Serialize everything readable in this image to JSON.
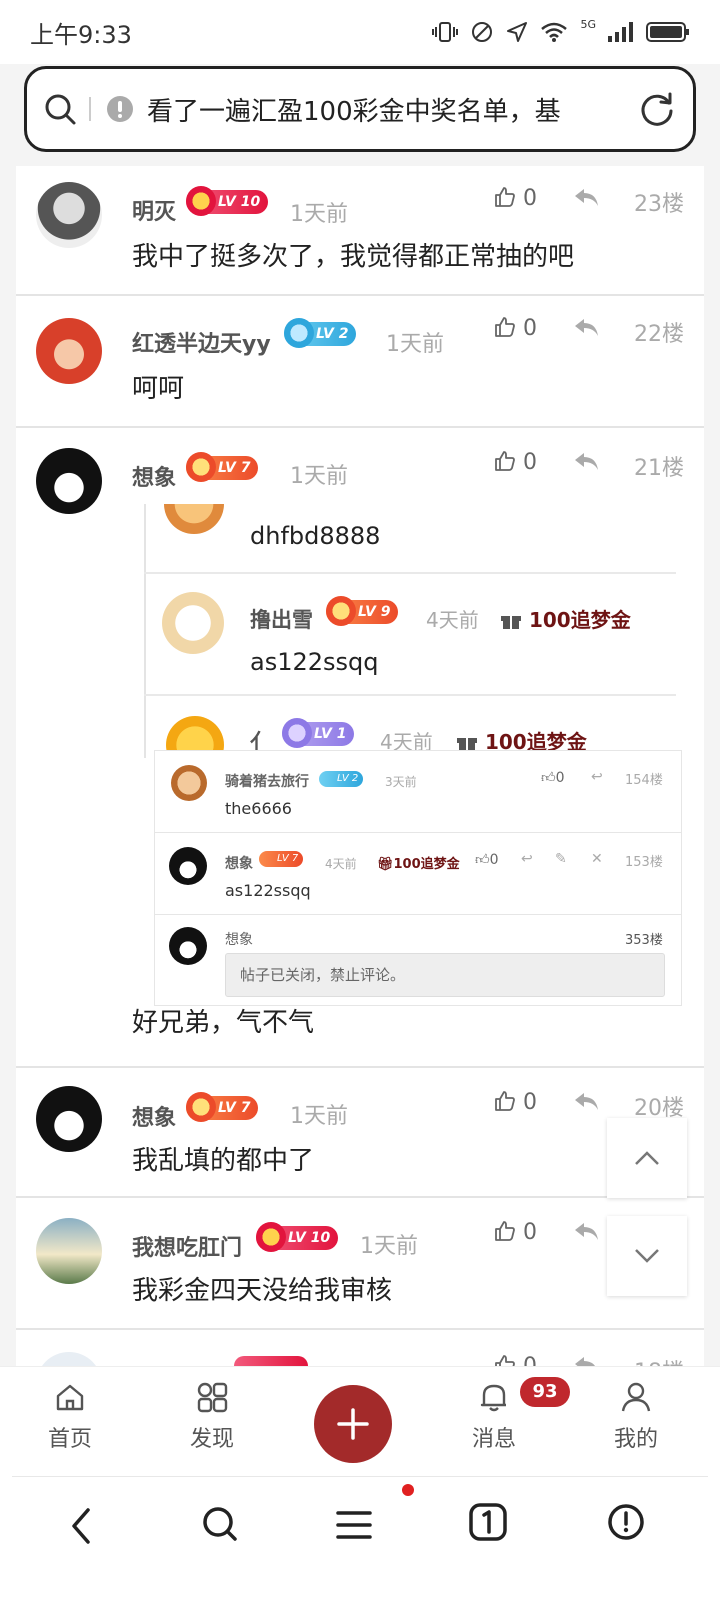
{
  "status_bar": {
    "time": "上午9:33",
    "network": "5G"
  },
  "search": {
    "query": "看了一遍汇盈100彩金中奖名单，基"
  },
  "comments": [
    {
      "name": "明灭",
      "level": "LV 10",
      "time": "1天前",
      "likes": "0",
      "floor": "23楼",
      "text": "我中了挺多次了，我觉得都正常抽的吧"
    },
    {
      "name": "红透半边天yy",
      "level": "LV 2",
      "time": "1天前",
      "likes": "0",
      "floor": "22楼",
      "text": "呵呵"
    },
    {
      "name": "想象",
      "level": "LV 7",
      "time": "1天前",
      "likes": "0",
      "floor": "21楼",
      "text": "好兄弟，气不气"
    },
    {
      "name": "想象",
      "level": "LV 7",
      "time": "1天前",
      "likes": "0",
      "floor": "20楼",
      "text": "我乱填的都中了"
    },
    {
      "name": "我想吃肛门",
      "level": "LV 10",
      "time": "1天前",
      "likes": "0",
      "floor": "",
      "text": "我彩金四天没给我审核"
    },
    {
      "likes": "0",
      "floor": "18楼"
    }
  ],
  "nested": {
    "row0": {
      "text": "dhfbd8888"
    },
    "row1": {
      "name": "撸出雪",
      "level": "LV 9",
      "time": "4天前",
      "gift": "100追梦金",
      "text": "as122ssqq"
    },
    "row2": {
      "name": "亻",
      "level": "LV 1",
      "time": "4天前",
      "gift": "100追梦金"
    }
  },
  "screenshot": {
    "rows": [
      {
        "name": "骑着猪去旅行",
        "level": "LV 2",
        "time": "3天前",
        "likes": "0",
        "floor": "154楼",
        "text": "the6666"
      },
      {
        "name": "想象",
        "level": "LV 7",
        "time": "4天前",
        "gift": "100追梦金",
        "likes": "0",
        "floor": "153楼",
        "text": "as122ssqq"
      },
      {
        "name": "想象",
        "floor": "353楼",
        "closed": "帖子已关闭，禁止评论。"
      }
    ]
  },
  "tabs": [
    {
      "label": "首页",
      "icon": "home-icon"
    },
    {
      "label": "发现",
      "icon": "discover-grid-icon"
    },
    {
      "label": "",
      "icon": "plus-icon"
    },
    {
      "label": "消息",
      "icon": "bell-icon",
      "badge": "93"
    },
    {
      "label": "我的",
      "icon": "person-icon"
    }
  ],
  "colors": {
    "accent": "#a32a2a",
    "badge": "#c0282d",
    "gift_text": "#6e1414"
  }
}
